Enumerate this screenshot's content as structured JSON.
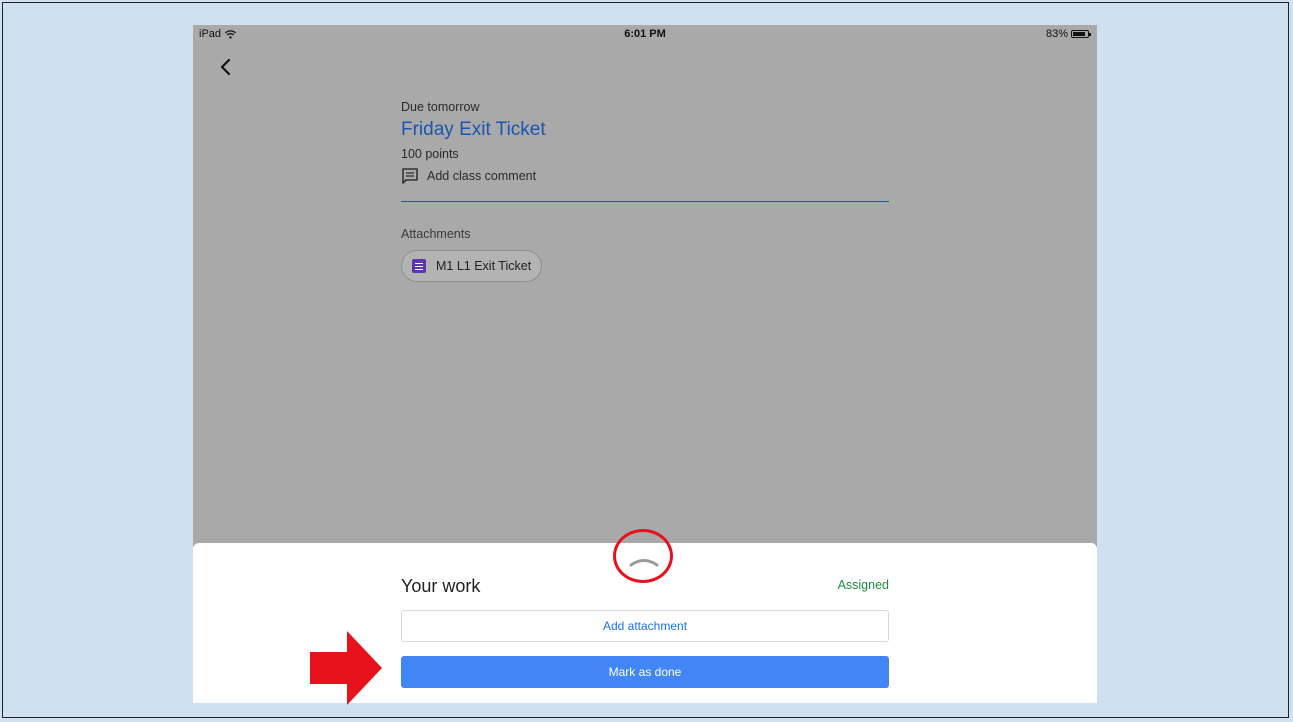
{
  "status_bar": {
    "device": "iPad",
    "time": "6:01 PM",
    "battery": "83%",
    "battery_level": 0.83
  },
  "assignment": {
    "due": "Due tomorrow",
    "title": "Friday Exit Ticket",
    "points": "100 points",
    "comment_label": "Add class comment",
    "attachments_label": "Attachments",
    "attachment_name": "M1 L1 Exit Ticket"
  },
  "work_panel": {
    "heading": "Your work",
    "status": "Assigned",
    "add_attachment": "Add attachment",
    "mark_done": "Mark as done"
  },
  "colors": {
    "title_blue": "#1a56b0",
    "status_green": "#1e8e3e",
    "primary_button": "#4285f4",
    "annotation_red": "#e8121c",
    "forms_purple": "#5e35b1"
  },
  "icons": [
    "wifi-icon",
    "battery-icon",
    "back-arrow-icon",
    "comment-icon",
    "google-forms-icon",
    "expand-handle-icon"
  ]
}
